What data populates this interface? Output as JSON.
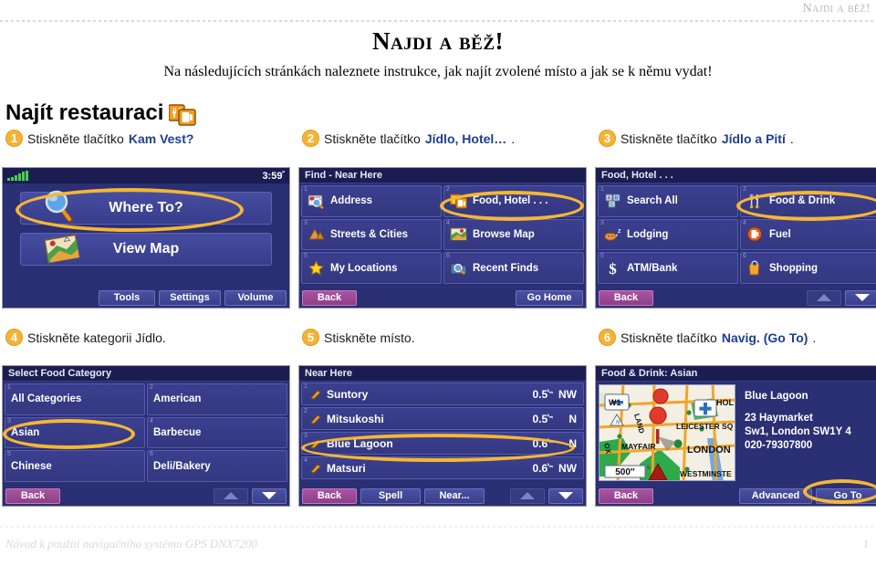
{
  "running_header": "Najdi a běž!",
  "doc": {
    "title": "Najdi a běž!",
    "intro": "Na následujících stránkách naleznete instrukce, jak najít zvolené místo a jak se k němu vydat!",
    "section_title": "Najít restauraci",
    "section_icon": "food-hotel-icon"
  },
  "footer": {
    "left": "Návod k použití navigačního systému GPS DNX7200",
    "page": "1"
  },
  "colors": {
    "highlight": "#f5b733",
    "screen_bg": "#2b2f74",
    "cell_bg": "#3b3f8f",
    "back_btn": "#a855a0",
    "link_blue": "#1c3f94"
  },
  "steps": [
    {
      "num": "1",
      "prefix": "Stiskněte tlačítko ",
      "bold": "Kam Vest?",
      "suffix": ""
    },
    {
      "num": "2",
      "prefix": "Stiskněte tlačítko ",
      "bold": "Jídlo, Hotel…",
      "suffix": "."
    },
    {
      "num": "3",
      "prefix": "Stiskněte tlačítko ",
      "bold": "Jídlo a Pití",
      "suffix": "."
    },
    {
      "num": "4",
      "prefix": "Stiskněte kategorii Jídlo.",
      "bold": "",
      "suffix": ""
    },
    {
      "num": "5",
      "prefix": "Stiskněte místo.",
      "bold": "",
      "suffix": ""
    },
    {
      "num": "6",
      "prefix": "Stiskněte tlačítko ",
      "bold": "Navig. (Go To)",
      "suffix": "."
    }
  ],
  "screen1": {
    "status": {
      "clock": "3:59",
      "clock_sup": "ᴾ",
      "signal_icon": "signal-bars-icon"
    },
    "buttons": [
      {
        "label": "Where To?",
        "icon": "magnifier-icon"
      },
      {
        "label": "View Map",
        "icon": "map-icon"
      }
    ],
    "footer_buttons": [
      "Tools",
      "Settings",
      "Volume"
    ]
  },
  "screen2": {
    "title": "Find - Near Here",
    "cells": [
      {
        "idx": "1",
        "label": "Address",
        "icon": "address-card-icon"
      },
      {
        "idx": "2",
        "label": "Food, Hotel . . .",
        "icon": "food-hotel-icon"
      },
      {
        "idx": "3",
        "label": "Streets & Cities",
        "icon": "streets-cities-icon"
      },
      {
        "idx": "4",
        "label": "Browse Map",
        "icon": "browse-map-icon"
      },
      {
        "idx": "5",
        "label": "My Locations",
        "icon": "star-icon"
      },
      {
        "idx": "6",
        "label": "Recent Finds",
        "icon": "recent-finds-icon"
      }
    ],
    "back": "Back",
    "go_home": "Go Home"
  },
  "screen3": {
    "title": "Food, Hotel . . .",
    "cells": [
      {
        "idx": "1",
        "label": "Search All",
        "icon": "search-all-icon"
      },
      {
        "idx": "2",
        "label": "Food & Drink",
        "icon": "food-drink-icon"
      },
      {
        "idx": "3",
        "label": "Lodging",
        "icon": "lodging-icon"
      },
      {
        "idx": "4",
        "label": "Fuel",
        "icon": "fuel-icon"
      },
      {
        "idx": "5",
        "label": "ATM/Bank",
        "icon": "atm-bank-icon"
      },
      {
        "idx": "6",
        "label": "Shopping",
        "icon": "shopping-icon"
      }
    ],
    "back": "Back"
  },
  "screen4": {
    "title": "Select Food Category",
    "cells": [
      {
        "idx": "1",
        "label": "All Categories"
      },
      {
        "idx": "2",
        "label": "American"
      },
      {
        "idx": "3",
        "label": "Asian"
      },
      {
        "idx": "4",
        "label": "Barbecue"
      },
      {
        "idx": "5",
        "label": "Chinese"
      },
      {
        "idx": "6",
        "label": "Deli/Bakery"
      }
    ],
    "back": "Back"
  },
  "screen5": {
    "title": "Near Here",
    "rows": [
      {
        "idx": "1",
        "name": "Suntory",
        "dist": "0.5",
        "unit": "ᵏₘ",
        "dir": "NW"
      },
      {
        "idx": "2",
        "name": "Mitsukoshi",
        "dist": "0.5",
        "unit": "ᵏₘ",
        "dir": "N"
      },
      {
        "idx": "3",
        "name": "Blue Lagoon",
        "dist": "0.6",
        "unit": "ᵏₘ",
        "dir": "N"
      },
      {
        "idx": "4",
        "name": "Matsuri",
        "dist": "0.6",
        "unit": "ᵏₘ",
        "dir": "NW"
      }
    ],
    "buttons": [
      "Back",
      "Spell",
      "Near..."
    ]
  },
  "screen6": {
    "title": "Food & Drink: Asian",
    "map": {
      "scale": "500″",
      "zoom_out": "−",
      "zoom_in": "+",
      "labels": [
        "W1",
        "LAND",
        "HOL",
        "LEICESTER SQ",
        "MAYFAIR",
        "LONDON",
        "WESTMINSTE",
        "OX"
      ]
    },
    "poi": {
      "name": "Blue Lagoon",
      "address1": "23 Haymarket",
      "address2": "Sw1, London SW1Y 4",
      "phone": "020-79307800"
    },
    "buttons": [
      "Back",
      "Advanced",
      "Go To"
    ]
  }
}
